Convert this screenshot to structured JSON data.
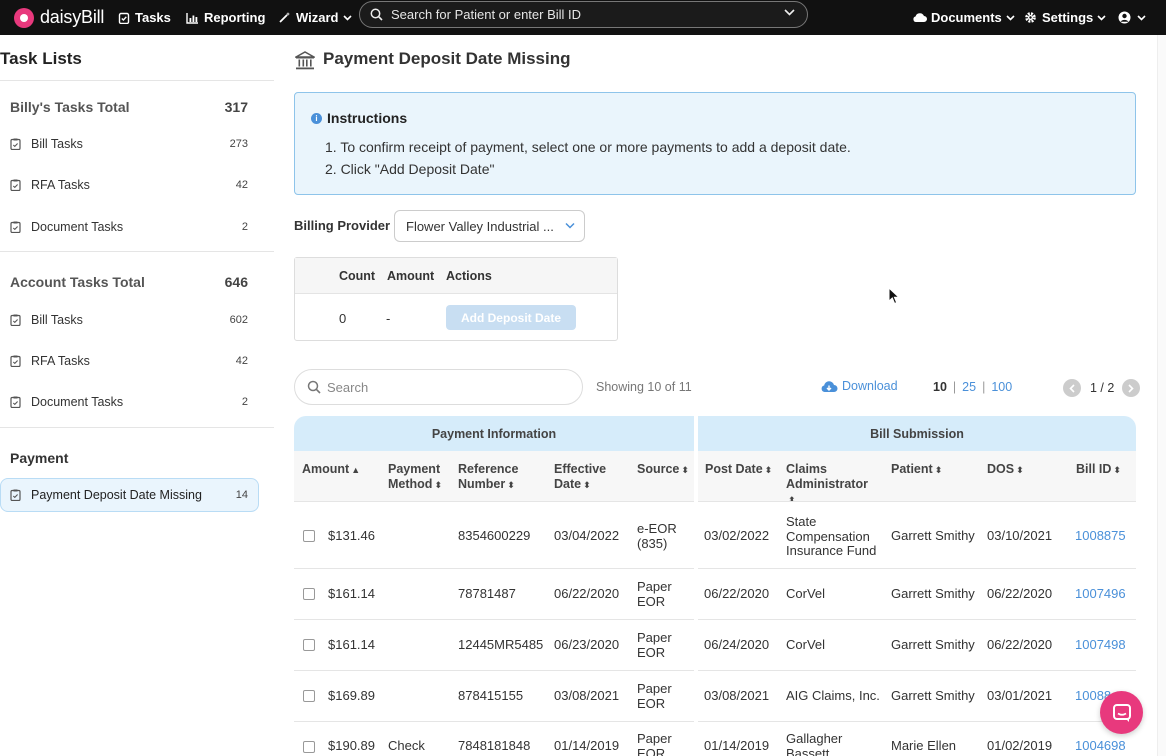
{
  "topbar": {
    "logo_text": "daisyBill",
    "tasks_label": "Tasks",
    "reporting_label": "Reporting",
    "wizard_label": "Wizard",
    "search_placeholder": "Search for Patient or enter Bill ID",
    "documents_label": "Documents",
    "settings_label": "Settings"
  },
  "sidebar": {
    "title": "Task Lists",
    "groups": [
      {
        "label": "Billy's Tasks Total",
        "count": "317",
        "items": [
          {
            "label": "Bill Tasks",
            "count": "273"
          },
          {
            "label": "RFA Tasks",
            "count": "42"
          },
          {
            "label": "Document Tasks",
            "count": "2"
          }
        ]
      },
      {
        "label": "Account Tasks Total",
        "count": "646",
        "items": [
          {
            "label": "Bill Tasks",
            "count": "602"
          },
          {
            "label": "RFA Tasks",
            "count": "42"
          },
          {
            "label": "Document Tasks",
            "count": "2"
          }
        ]
      },
      {
        "label": "Payment",
        "count": "",
        "items": [
          {
            "label": "Payment Deposit Date Missing",
            "count": "14"
          }
        ]
      }
    ]
  },
  "main": {
    "title": "Payment Deposit Date Missing",
    "instructions": {
      "heading": "Instructions",
      "lines": [
        "1. To confirm receipt of payment, select one or more payments to add a deposit date.",
        "2. Click \"Add Deposit Date\""
      ]
    },
    "billing_provider": {
      "label": "Billing Provider",
      "value": "Flower Valley Industrial ..."
    },
    "summary": {
      "headers": [
        "Count",
        "Amount",
        "Actions"
      ],
      "count": "0",
      "amount": "-",
      "action_label": "Add Deposit Date"
    },
    "table_controls": {
      "search_placeholder": "Search",
      "showing": "Showing 10 of 11",
      "download_label": "Download",
      "page_sizes": [
        "10",
        "25",
        "100"
      ],
      "page_size_selected": "10",
      "separator": "|",
      "page_indicator": "1 / 2"
    },
    "table": {
      "groups": [
        "Payment Information",
        "Bill Submission"
      ],
      "columns": [
        "Amount",
        "Payment Method",
        "Reference Number",
        "Effective Date",
        "Source",
        "Post Date",
        "Claims Administrator",
        "Patient",
        "DOS",
        "Bill ID"
      ],
      "rows": [
        {
          "amount": "$131.46",
          "method": "",
          "reference": "8354600229",
          "effective": "03/04/2022",
          "source": "e-EOR (835)",
          "post": "03/02/2022",
          "administrator": "State Compensation Insurance Fund",
          "patient": "Garrett Smithy",
          "dos": "03/10/2021",
          "bill_id": "1008875"
        },
        {
          "amount": "$161.14",
          "method": "",
          "reference": "78781487",
          "effective": "06/22/2020",
          "source": "Paper EOR",
          "post": "06/22/2020",
          "administrator": "CorVel",
          "patient": "Garrett Smithy",
          "dos": "06/22/2020",
          "bill_id": "1007496"
        },
        {
          "amount": "$161.14",
          "method": "",
          "reference": "12445MR5485",
          "effective": "06/23/2020",
          "source": "Paper EOR",
          "post": "06/24/2020",
          "administrator": "CorVel",
          "patient": "Garrett Smithy",
          "dos": "06/22/2020",
          "bill_id": "1007498"
        },
        {
          "amount": "$169.89",
          "method": "",
          "reference": "878415155",
          "effective": "03/08/2021",
          "source": "Paper EOR",
          "post": "03/08/2021",
          "administrator": "AIG Claims, Inc.",
          "patient": "Garrett Smithy",
          "dos": "03/01/2021",
          "bill_id": "10088"
        },
        {
          "amount": "$190.89",
          "method": "Check",
          "reference": "7848181848",
          "effective": "01/14/2019",
          "source": "Paper EOR",
          "post": "01/14/2019",
          "administrator": "Gallagher Bassett",
          "patient": "Marie Ellen",
          "dos": "01/02/2019",
          "bill_id": "1004698"
        }
      ]
    }
  },
  "colors": {
    "accent": "#4a90d9",
    "brand": "#e8397d",
    "topbar": "#111111",
    "info_bg": "#eaf5fc"
  }
}
